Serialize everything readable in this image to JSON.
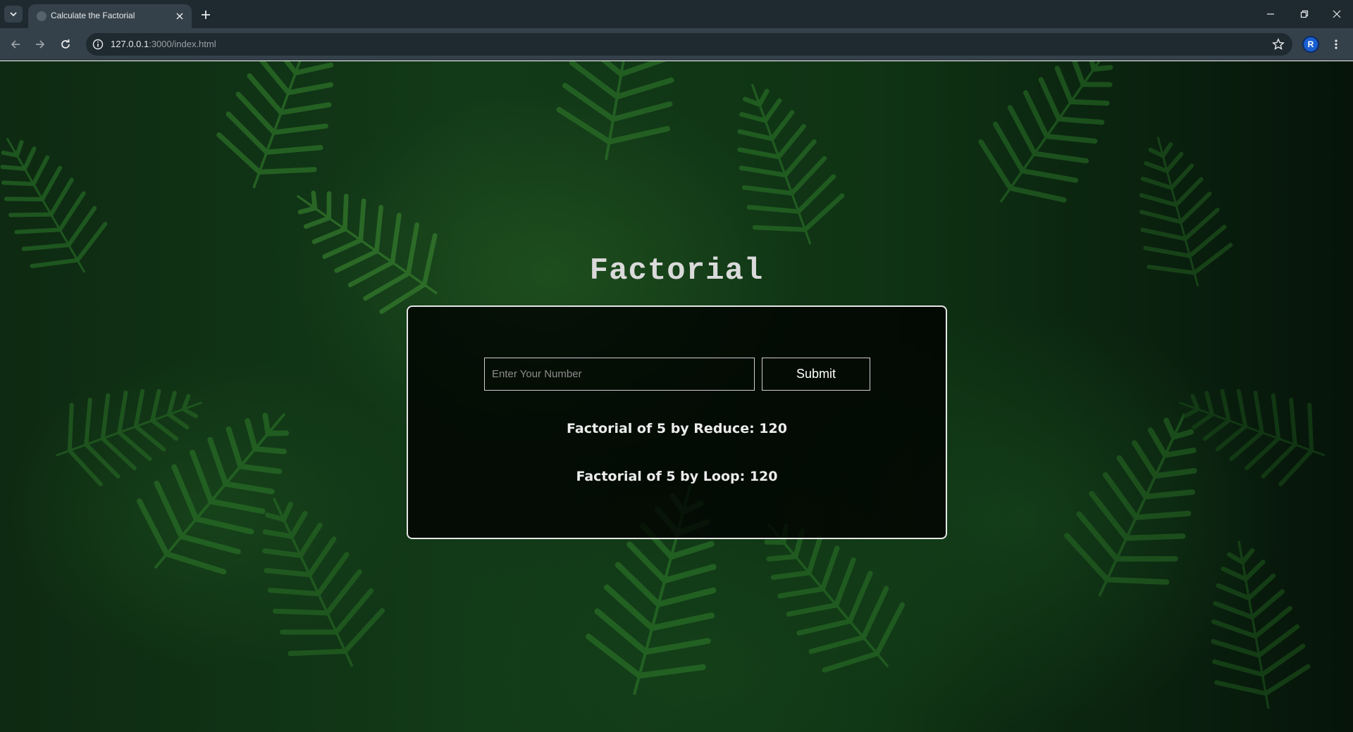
{
  "browser": {
    "tab": {
      "title": "Calculate the Factorial"
    },
    "address_bar": {
      "host": "127.0.0.1",
      "path": ":3000/index.html"
    },
    "profile_initial": "R",
    "icons": {
      "tab_search": "chevron-down-icon",
      "tab_close": "close-icon",
      "new_tab": "plus-icon",
      "back": "arrow-left-icon",
      "forward": "arrow-right-icon",
      "reload": "reload-icon",
      "site_info": "info-icon",
      "bookmark": "star-icon",
      "menu": "more-vertical-icon"
    }
  },
  "page": {
    "title": "Factorial",
    "input": {
      "placeholder": "Enter Your Number",
      "value": ""
    },
    "submit_label": "Submit",
    "results": {
      "reduce": "Factorial of 5 by Reduce: 120",
      "loop": "Factorial of 5 by Loop: 120"
    }
  },
  "colors": {
    "chrome_dark": "#1f2a30",
    "chrome_toolbar": "#34414a",
    "background_green": "#123a18",
    "card_border": "#e6e6e6",
    "text_light": "#ececec"
  }
}
